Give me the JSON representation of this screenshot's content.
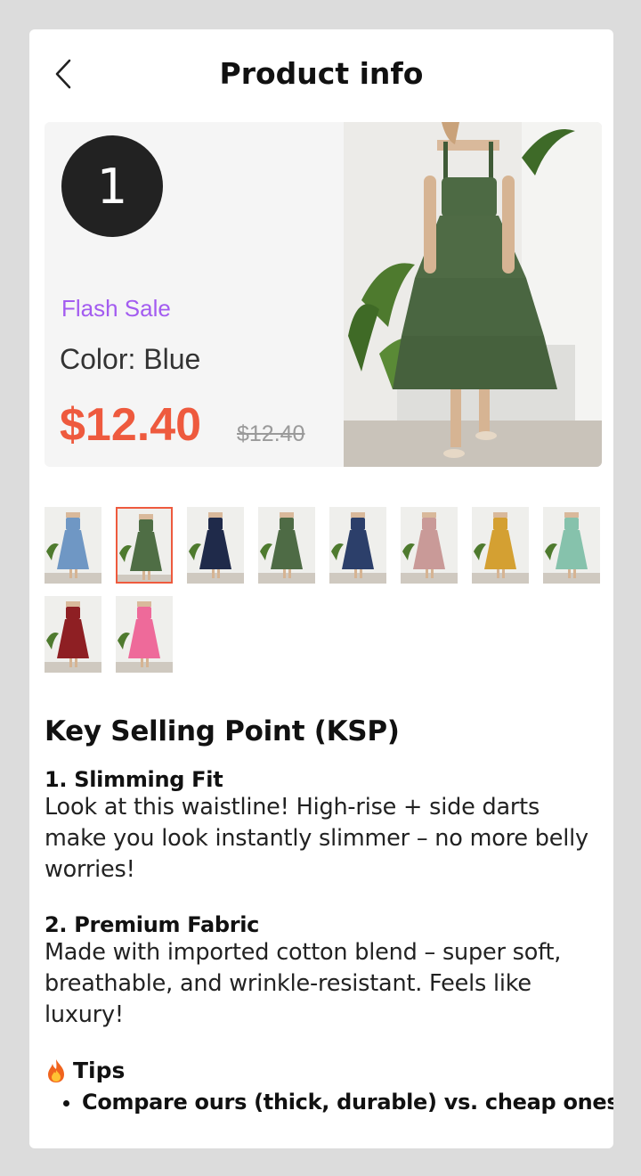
{
  "header": {
    "title": "Product info",
    "back_icon": "chevron-left-icon"
  },
  "hero": {
    "badge_number": "1",
    "flash_sale": "Flash Sale",
    "color_label": "Color:",
    "color_value": "Blue",
    "price": "$12.40",
    "original_price": "$12.40"
  },
  "variants": [
    {
      "color": "#6f97c4"
    },
    {
      "color": "#4f6e45",
      "selected": true
    },
    {
      "color": "#1f2a4a"
    },
    {
      "color": "#4e6b45"
    },
    {
      "color": "#2c3f6a"
    },
    {
      "color": "#c99a98"
    },
    {
      "color": "#d4a032"
    },
    {
      "color": "#86c2ac"
    },
    {
      "color": "#8e1f23"
    },
    {
      "color": "#ee6a9a"
    }
  ],
  "ksp": {
    "title": "Key Selling Point (KSP)",
    "points": [
      {
        "title": "1. Slimming Fit",
        "body": "Look at this waistline! High-rise + side darts make you look instantly slimmer – no more belly worries!"
      },
      {
        "title": "2. Premium Fabric",
        "body": "Made with imported cotton blend – super soft, breathable, and wrinkle-resistant. Feels like luxury!"
      }
    ],
    "tips": {
      "icon": "fire-icon",
      "title": "Tips",
      "items": [
        "Compare ours (thick, durable) vs. cheap ones"
      ]
    }
  },
  "colors": {
    "accent": "#ee5a3e",
    "flash_sale": "#a35cf0",
    "dress_main": "#4f6b45"
  }
}
